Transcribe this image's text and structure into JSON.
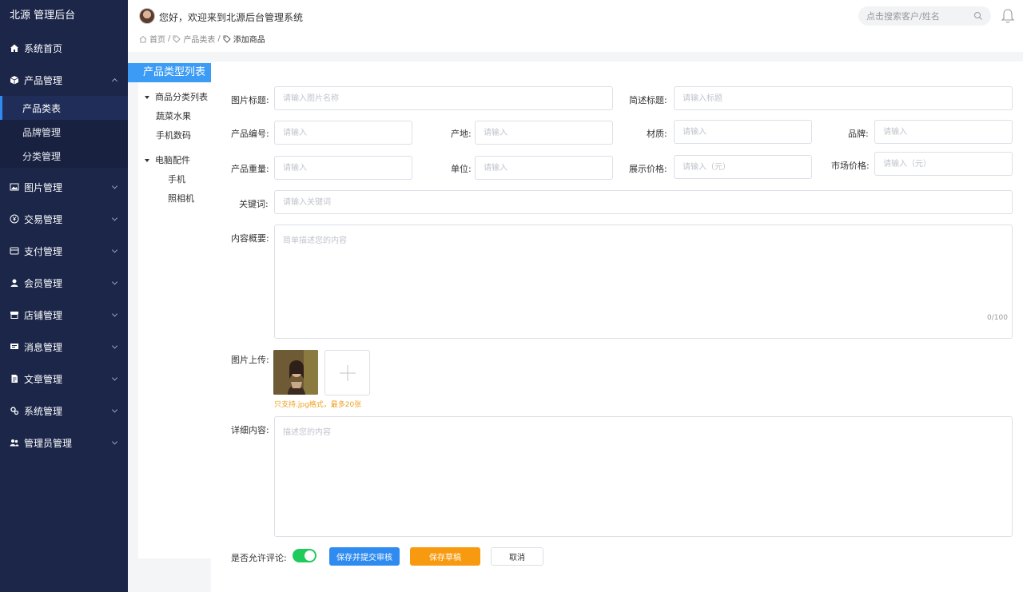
{
  "sidebar": {
    "brand": "北源 管理后台",
    "items": [
      {
        "label": "系统首页"
      },
      {
        "label": "产品管理"
      },
      {
        "label": "图片管理"
      },
      {
        "label": "交易管理"
      },
      {
        "label": "支付管理"
      },
      {
        "label": "会员管理"
      },
      {
        "label": "店铺管理"
      },
      {
        "label": "消息管理"
      },
      {
        "label": "文章管理"
      },
      {
        "label": "系统管理"
      },
      {
        "label": "管理员管理"
      }
    ],
    "product_sub": [
      {
        "label": "产品类表"
      },
      {
        "label": "品牌管理"
      },
      {
        "label": "分类管理"
      }
    ]
  },
  "header": {
    "welcome": "您好，欢迎来到北源后台管理系统",
    "breadcrumb": {
      "home": "首页",
      "sep": "/",
      "category": "产品类表",
      "current": "添加商品"
    },
    "search_placeholder": "点击搜索客户/姓名"
  },
  "tree": {
    "title": "产品类型列表",
    "nodes": [
      {
        "label": "商品分类列表"
      },
      {
        "label": "蔬菜水果"
      },
      {
        "label": "手机数码"
      },
      {
        "label": "电脑配件"
      },
      {
        "label": "手机"
      },
      {
        "label": "照相机"
      }
    ]
  },
  "form": {
    "labels": {
      "image_title": "图片标题:",
      "brief_title": "简述标题:",
      "product_no": "产品编号:",
      "origin": "产地:",
      "material": "材质:",
      "brand": "品牌:",
      "weight": "产品重量:",
      "unit": "单位:",
      "display_price": "展示价格:",
      "market_price": "市场价格:",
      "keywords": "关键词:",
      "summary": "内容概要:",
      "upload": "图片上传:",
      "detail": "详细内容:",
      "allow_comment": "是否允许评论:"
    },
    "placeholders": {
      "image_title": "请输入图片名称",
      "brief_title": "请输入标题",
      "product_no": "请输入",
      "origin": "请输入",
      "material": "请输入",
      "brand": "请输入",
      "weight": "请输入",
      "unit": "请输入",
      "display_price": "请输入（元）",
      "market_price": "请输入（元）",
      "keywords": "请输入关键词",
      "summary": "简单描述您的内容",
      "detail": "描述您的内容"
    },
    "summary_counter": "0/100",
    "upload_hint": "只支持.jpg格式，最多20张",
    "allow_comment": true,
    "buttons": {
      "submit": "保存并提交审核",
      "draft": "保存草稿",
      "cancel": "取消"
    }
  },
  "colors": {
    "sidebar_bg": "#1b2649",
    "primary": "#2f8bf0",
    "warning": "#f79a10",
    "switch_on": "#1fcb5b"
  }
}
